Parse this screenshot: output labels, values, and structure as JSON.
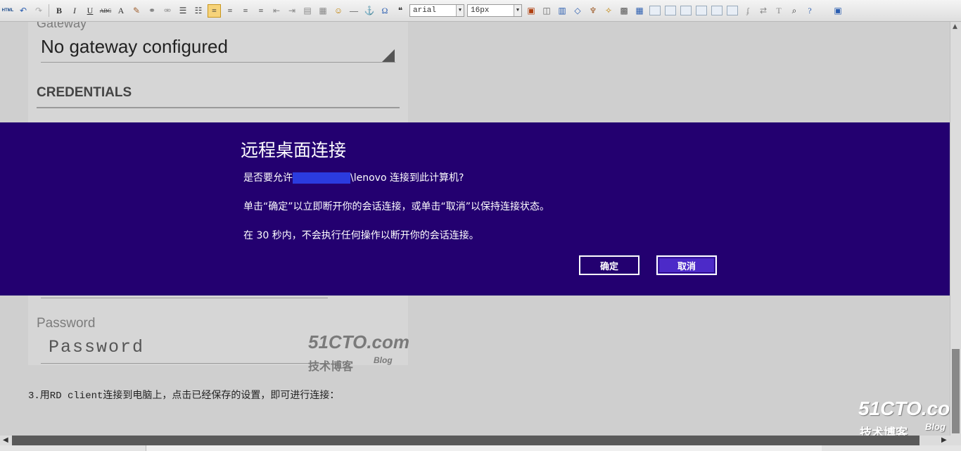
{
  "toolbar": {
    "html_label": "HTML",
    "bold": "B",
    "italic": "I",
    "underline": "U",
    "strike": "ABC",
    "font_color": "A",
    "font_family": "arial",
    "font_size": "16px",
    "omega": "Ω",
    "quote": "❝"
  },
  "rd_form": {
    "gateway_label": "Gateway",
    "gateway_value": "No gateway configured",
    "credentials_heading": "CREDENTIALS",
    "password_label": "Password",
    "password_placeholder": "Password"
  },
  "dialog": {
    "title": "远程桌面连接",
    "line1_prefix": "是否要允许",
    "line1_suffix": "\\lenovo 连接到此计算机?",
    "line2": "单击“确定”以立即断开你的会话连接，或单击“取消”以保持连接状态。",
    "line3": "在 30 秒内，不会执行任何操作以断开你的会话连接。",
    "ok_label": "确定",
    "cancel_label": "取消",
    "overlay_color": "#230070",
    "cancel_bg": "#4c2ac8"
  },
  "article": {
    "step3": "3.用RD client连接到电脑上，点击已经保存的设置，即可进行连接："
  },
  "watermark": {
    "site": "51CTO.com",
    "sub": "技术博客",
    "blog": "Blog"
  }
}
